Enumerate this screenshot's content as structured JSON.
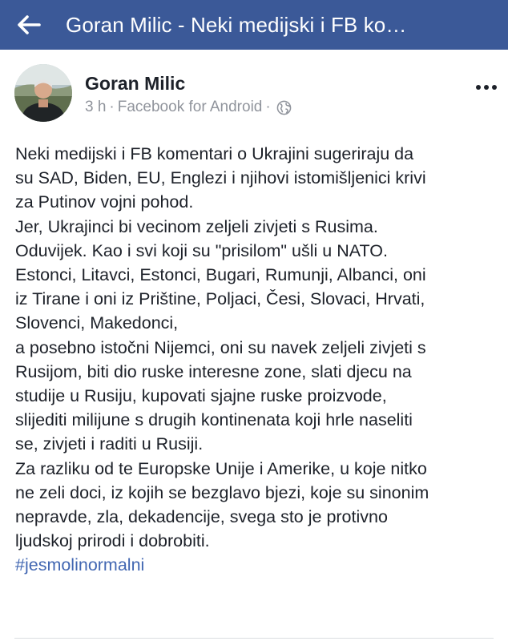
{
  "header": {
    "title": "Goran Milic - Neki medijski i FB ko…",
    "back_icon": "arrow-left-icon",
    "background": "#3b5998"
  },
  "post": {
    "author": "Goran Milic",
    "time": "3 h",
    "separator": "·",
    "source": "Facebook for Android",
    "privacy_icon": "globe-icon",
    "more_icon": "more-horizontal-icon",
    "lines": [
      "Neki medijski i FB komentari o Ukrajini sugeriraju da",
      "su SAD, Biden, EU, Englezi i njihovi istomišljenici krivi",
      "za Putinov vojni pohod.",
      "Jer, Ukrajinci bi vecinom zeljeli zivjeti s Rusima.",
      "Oduvijek. Kao i svi koji su \"prisilom\" ušli u NATO.",
      "Estonci, Litavci, Estonci, Bugari, Rumunji, Albanci, oni",
      "iz Tirane i oni iz Prištine, Poljaci, Česi, Slovaci, Hrvati,",
      "Slovenci, Makedonci,",
      "a posebno istočni Nijemci, oni su navek zeljeli zivjeti s",
      "Rusijom, biti dio ruske interesne zone, slati djecu na",
      "studije u Rusiju, kupovati sjajne ruske proizvode,",
      "slijediti milijune s drugih kontinenata koji hrle naseliti",
      "se, zivjeti i raditi u Rusiji.",
      "Za razliku od te Europske Unije i Amerike, u koje nitko",
      "ne zeli doci, iz kojih se bezglavo bjezi, koje su sinonim",
      "nepravde, zla, dekadencije, svega sto je protivno",
      "ljudskoj prirodi i dobrobiti."
    ],
    "hashtag": "#jesmolinormalni",
    "hashtag_color": "#4267b2"
  }
}
